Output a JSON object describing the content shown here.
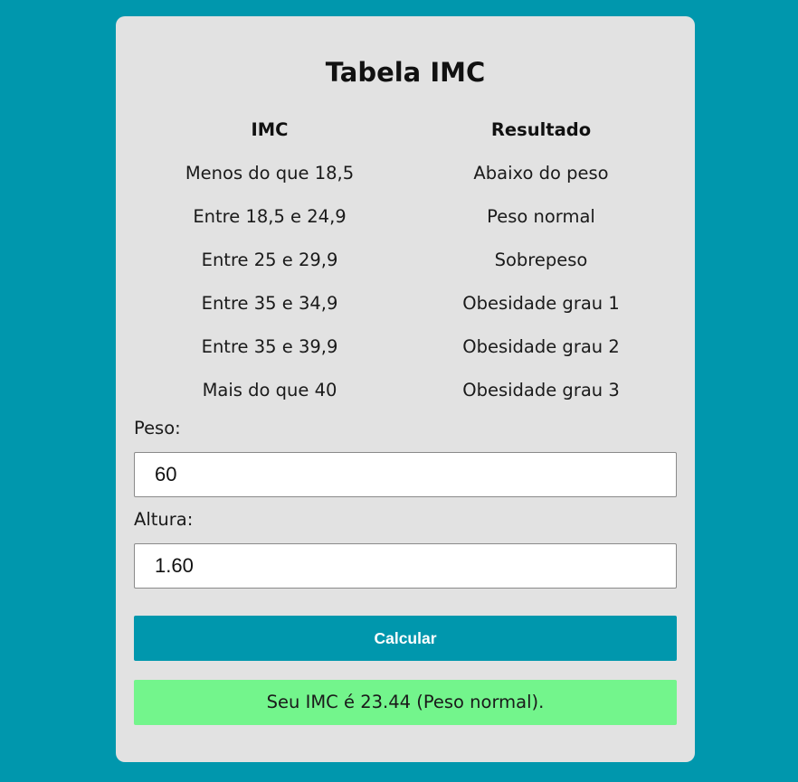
{
  "title": "Tabela IMC",
  "table": {
    "headers": [
      "IMC",
      "Resultado"
    ],
    "rows": [
      [
        "Menos do que 18,5",
        "Abaixo do peso"
      ],
      [
        "Entre 18,5 e 24,9",
        "Peso normal"
      ],
      [
        "Entre 25 e 29,9",
        "Sobrepeso"
      ],
      [
        "Entre 35 e 34,9",
        "Obesidade grau 1"
      ],
      [
        "Entre 35 e 39,9",
        "Obesidade grau 2"
      ],
      [
        "Mais do que 40",
        "Obesidade grau 3"
      ]
    ]
  },
  "form": {
    "peso_label": "Peso:",
    "peso_value": "60",
    "altura_label": "Altura:",
    "altura_value": "1.60",
    "button_label": "Calcular"
  },
  "result": {
    "text": "Seu IMC é 23.44 (Peso normal)."
  },
  "colors": {
    "background": "#0097ad",
    "card": "#e2e2e2",
    "button": "#0097ad",
    "result": "#73f58c"
  }
}
